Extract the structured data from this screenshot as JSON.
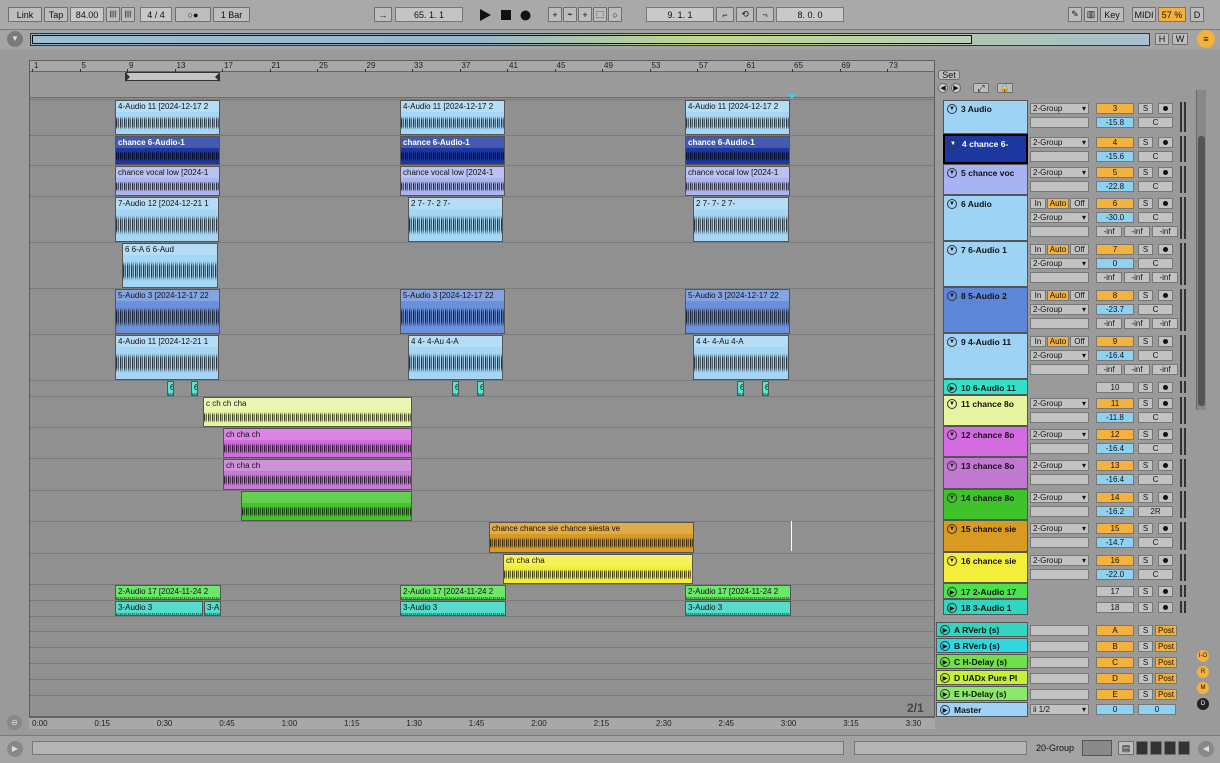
{
  "toolbar": {
    "link": "Link",
    "tap": "Tap",
    "tempo": "84.00",
    "signature": "4 / 4",
    "metronome": "○●",
    "quantize": "1 Bar",
    "position": "65.  1.  1",
    "loop_start": "9.  1.  1",
    "loop_length": "8.  0.  0",
    "key": "Key",
    "midi": "MIDI",
    "cpu": "57 %",
    "disk": "D"
  },
  "overview": {
    "h": "H",
    "w": "W"
  },
  "ruler": {
    "bars": [
      "1",
      "5",
      "9",
      "13",
      "17",
      "21",
      "25",
      "29",
      "33",
      "37",
      "41",
      "45",
      "49",
      "53",
      "57",
      "61",
      "65",
      "69",
      "73"
    ]
  },
  "timeline": {
    "labels": [
      "0:00",
      "0:15",
      "0:30",
      "0:45",
      "1:00",
      "1:15",
      "1:30",
      "1:45",
      "2:00",
      "2:15",
      "2:30",
      "2:45",
      "3:00",
      "3:15",
      "3:30"
    ]
  },
  "set": {
    "label": "Set"
  },
  "page_indicator": "2/1",
  "clips": {
    "t3": "4-Audio 11 [2024-12-17 2",
    "t4": "chance   6-Audio-1",
    "t5": "chance vocal low [2024-1",
    "t5b": "chance vocal low [2024-1",
    "t6": "7-Audio 12 [2024-12-21 1",
    "t6b": "2 7- 7- 2 7-",
    "t7": "6 6-A 6 6-Aud",
    "t8": "5-Audio 3 [2024-12-17 22",
    "t9": "4-Audio 11 [2024-12-21 1",
    "t9b": "4 4- 4-Au 4-A",
    "t10": "6",
    "t11": "c ch ch cha",
    "t12": "ch cha ch",
    "t15": "chance chance sie chance siesta ve",
    "t16": "ch cha cha",
    "t17": "2-Audio 17 [2024-11-24 2",
    "t18": "3-Audio 3",
    "t18b": "3-A"
  },
  "tracks": [
    {
      "name": "3 Audio",
      "color": "#9fd3f5",
      "num": "3",
      "vol": "-15.8",
      "route": "2-Group"
    },
    {
      "name": "4 chance  6-",
      "color": "#1d37a0",
      "num": "4",
      "vol": "-15.6",
      "route": "2-Group"
    },
    {
      "name": "5 chance voc",
      "color": "#a7b3f2",
      "num": "5",
      "vol": "-22.8",
      "route": "2-Group"
    },
    {
      "name": "6 Audio",
      "color": "#9fd3f5",
      "num": "6",
      "vol": "-30.0",
      "route": "2-Group",
      "in": "In",
      "auto": "Auto",
      "off": "Off",
      "inf": "-inf"
    },
    {
      "name": "7 6-Audio 1",
      "color": "#9fd3f5",
      "num": "7",
      "vol": "0",
      "route": "2-Group",
      "in": "In",
      "auto": "Auto",
      "off": "Off",
      "inf": "-inf"
    },
    {
      "name": "8 5-Audio 2",
      "color": "#5e86d8",
      "num": "8",
      "vol": "-23.7",
      "route": "2-Group",
      "in": "In",
      "auto": "Auto",
      "off": "Off",
      "inf": "-inf"
    },
    {
      "name": "9 4-Audio 11",
      "color": "#9fd3f5",
      "num": "9",
      "vol": "-16.4",
      "route": "2-Group",
      "in": "In",
      "auto": "Auto",
      "off": "Off",
      "inf": "-inf"
    },
    {
      "name": "10 6-Audio 11",
      "color": "#33e0c8",
      "num": "10"
    },
    {
      "name": "11 chance 8o",
      "color": "#e8f5a0",
      "num": "11",
      "vol": "-11.8",
      "route": "2-Group"
    },
    {
      "name": "12 chance 8o",
      "color": "#d56be0",
      "num": "12",
      "vol": "-16.4",
      "route": "2-Group"
    },
    {
      "name": "13 chance 8o",
      "color": "#c078d0",
      "num": "13",
      "vol": "-16.4",
      "route": "2-Group"
    },
    {
      "name": "14 chance 8o",
      "color": "#3fc22a",
      "num": "14",
      "vol": "-16.2",
      "route": "2-Group",
      "pan": "2R"
    },
    {
      "name": "15 chance sie",
      "color": "#d99a22",
      "num": "15",
      "vol": "-14.7",
      "route": "2-Group"
    },
    {
      "name": "16 chance sie",
      "color": "#f3ee3a",
      "num": "16",
      "vol": "-22.0",
      "route": "2-Group"
    },
    {
      "name": "17 2-Audio 17",
      "color": "#4ce24a",
      "num": "17"
    },
    {
      "name": "18 3-Audio 1",
      "color": "#33d4c0",
      "num": "18"
    }
  ],
  "c_label": "C",
  "s_label": "S",
  "returns": [
    {
      "name": "A RVerb (s)",
      "color": "#33d4c0",
      "letter": "A",
      "post": "Post"
    },
    {
      "name": "B RVerb (s)",
      "color": "#2fd8e0",
      "letter": "B",
      "post": "Post"
    },
    {
      "name": "C H-Delay (s)",
      "color": "#6fe04a",
      "letter": "C",
      "post": "Post"
    },
    {
      "name": "D UADx Pure Pl",
      "color": "#c4f03a",
      "letter": "D",
      "post": "Post"
    },
    {
      "name": "E H-Delay (s)",
      "color": "#8ae86a",
      "letter": "E",
      "post": "Post"
    }
  ],
  "master": {
    "name": "Master",
    "route": "ii 1/2",
    "num": "0",
    "vol": "0"
  },
  "right_icons": [
    "I-O",
    "R",
    "M",
    "D"
  ],
  "bottom": {
    "group": "20-Group"
  }
}
